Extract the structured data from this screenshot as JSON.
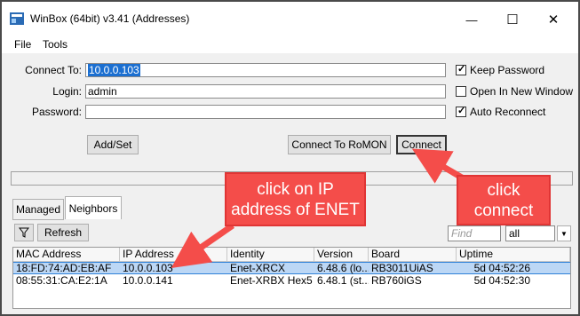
{
  "window": {
    "title": "WinBox (64bit) v3.41 (Addresses)",
    "minimize_glyph": "—",
    "maximize_glyph": "☐",
    "close_glyph": "✕"
  },
  "menu": {
    "file": "File",
    "tools": "Tools"
  },
  "form": {
    "connect_to_label": "Connect To:",
    "connect_to_value": "10.0.0.103",
    "login_label": "Login:",
    "login_value": "admin",
    "password_label": "Password:",
    "password_value": "",
    "keep_password_label": "Keep Password",
    "keep_password_checked": true,
    "open_new_window_label": "Open In New Window",
    "open_new_window_checked": false,
    "auto_reconnect_label": "Auto Reconnect",
    "auto_reconnect_checked": true
  },
  "buttons": {
    "add_set": "Add/Set",
    "connect_romon": "Connect To RoMON",
    "connect": "Connect",
    "refresh": "Refresh"
  },
  "tabs": {
    "managed": "Managed",
    "neighbors": "Neighbors"
  },
  "filter": {
    "find_placeholder": "Find",
    "scope_value": "all"
  },
  "table": {
    "columns": [
      "MAC Address",
      "IP Address",
      "Identity",
      "Version",
      "Board",
      "Uptime"
    ],
    "rows": [
      [
        "18:FD:74:AD:EB:AF",
        "10.0.0.103",
        "Enet-XRCX",
        "6.48.6 (lo...",
        "RB3011UiAS",
        "5d 04:52:26"
      ],
      [
        "08:55:31:CA:E2:1A",
        "10.0.0.141",
        "Enet-XRBX Hex5",
        "6.48.1 (st...",
        "RB760iGS",
        "5d 04:52:30"
      ]
    ],
    "selected_row": 0
  },
  "annotations": {
    "ip_callout": "click on IP address of ENET",
    "connect_callout": "click connect"
  },
  "colors": {
    "callout": "#f44d4a",
    "selection": "#bcd7f5"
  }
}
